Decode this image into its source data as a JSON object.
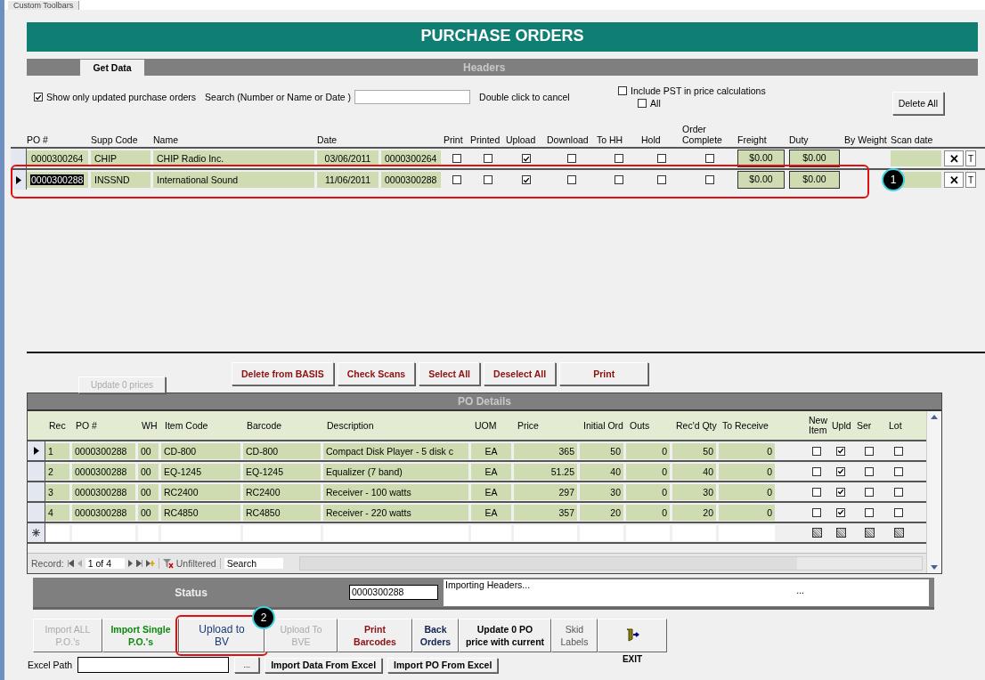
{
  "top_tab": {
    "label": "Custom Toolbars"
  },
  "title": "PURCHASE ORDERS",
  "headers_bar": {
    "tab": "Get Data",
    "title": "Headers"
  },
  "options": {
    "show_updated": {
      "label": "Show only updated purchase orders",
      "checked": true
    },
    "search": {
      "label": "Search (Number or Name or Date )"
    },
    "cancel_hint": "Double click to cancel",
    "include_pst": {
      "label": "Include PST in price calculations",
      "checked": false
    },
    "all": {
      "label": "All",
      "checked": false
    },
    "delete_all": "Delete All"
  },
  "headers_table": {
    "columns": [
      "PO #",
      "Supp Code",
      "Name",
      "Date",
      "Print",
      "Printed",
      "Upload",
      "Download",
      "To HH",
      "Hold",
      "Order\nComplete",
      "Freight",
      "Duty",
      "By Weight",
      "Scan date"
    ],
    "rows": [
      {
        "selected": false,
        "po": "0000300264",
        "supp_code": "CHIP",
        "name": "CHIP Radio Inc.",
        "date": "03/06/2011",
        "po_ref": "0000300264",
        "print": false,
        "printed": false,
        "upload": true,
        "download": false,
        "to_hh": false,
        "hold": false,
        "order_complete": false,
        "freight": "$0.00",
        "duty": "$0.00",
        "delete": "✕",
        "t": "T"
      },
      {
        "selected": true,
        "po": "0000300288",
        "supp_code": "INSSND",
        "name": "International Sound",
        "date": "11/06/2011",
        "po_ref": "0000300288",
        "print": false,
        "printed": false,
        "upload": true,
        "download": false,
        "to_hh": false,
        "hold": false,
        "order_complete": false,
        "freight": "$0.00",
        "duty": "$0.00",
        "delete": "✕",
        "t": "T"
      }
    ]
  },
  "actions": {
    "update_prices": {
      "label": "Update 0 prices",
      "disabled": true
    },
    "buttons": [
      "Delete from BASIS",
      "Check Scans",
      "Select All",
      "Deselect All",
      "Print"
    ]
  },
  "details": {
    "title": "PO Details",
    "columns": [
      "Rec",
      "PO #",
      "WH",
      "Item Code",
      "Barcode",
      "Description",
      "UOM",
      "Price",
      "Initial Ord",
      "Outs",
      "Rec'd Qty",
      "To Receive",
      "New\nItem",
      "Upld",
      "Ser",
      "Lot"
    ],
    "rows": [
      {
        "selected": true,
        "rec": "1",
        "po": "0000300288",
        "wh": "00",
        "item_code": "CD-800",
        "barcode": "CD-800",
        "description": "Compact Disk Player - 5 disk c",
        "uom": "EA",
        "price": "365",
        "initial_ord": "50",
        "outs": "0",
        "recd_qty": "50",
        "to_receive": "0",
        "new_item": false,
        "upld": true,
        "ser": false,
        "lot": false
      },
      {
        "selected": false,
        "rec": "2",
        "po": "0000300288",
        "wh": "00",
        "item_code": "EQ-1245",
        "barcode": "EQ-1245",
        "description": "Equalizer (7 band)",
        "uom": "EA",
        "price": "51.25",
        "initial_ord": "40",
        "outs": "0",
        "recd_qty": "40",
        "to_receive": "0",
        "new_item": false,
        "upld": true,
        "ser": false,
        "lot": false
      },
      {
        "selected": false,
        "rec": "3",
        "po": "0000300288",
        "wh": "00",
        "item_code": "RC2400",
        "barcode": "RC2400",
        "description": "Receiver - 100 watts",
        "uom": "EA",
        "price": "297",
        "initial_ord": "30",
        "outs": "0",
        "recd_qty": "30",
        "to_receive": "0",
        "new_item": false,
        "upld": true,
        "ser": false,
        "lot": false
      },
      {
        "selected": false,
        "rec": "4",
        "po": "0000300288",
        "wh": "00",
        "item_code": "RC4850",
        "barcode": "RC4850",
        "description": "Receiver - 220 watts",
        "uom": "EA",
        "price": "357",
        "initial_ord": "20",
        "outs": "0",
        "recd_qty": "20",
        "to_receive": "0",
        "new_item": false,
        "upld": true,
        "ser": false,
        "lot": false
      }
    ],
    "navigation": {
      "label": "Record:",
      "position": "1 of 4",
      "filter": "Unfiltered",
      "search": "Search"
    }
  },
  "status": {
    "label": "Status",
    "po": "0000300288",
    "message": "Importing Headers...",
    "more": "..."
  },
  "bottom_buttons": [
    {
      "label": "Import ALL\nP.O.'s",
      "kind": "disabled"
    },
    {
      "label": "Import Single\nP.O.'s",
      "kind": "green"
    },
    {
      "label": "Upload to\nBV",
      "kind": "blue"
    },
    {
      "label": "Upload To\nBVE",
      "kind": "disabled"
    },
    {
      "label": "Print\nBarcodes",
      "kind": "red"
    },
    {
      "label": "Back\nOrders",
      "kind": "navy"
    },
    {
      "label": "Update 0 PO\nprice with current",
      "kind": "bold"
    },
    {
      "label": "Skid\nLabels",
      "kind": "plain"
    }
  ],
  "exit": {
    "label": "EXIT"
  },
  "excel": {
    "label": "Excel Path",
    "browse": "...",
    "import_data": "Import Data From Excel",
    "import_po": "Import PO From Excel"
  },
  "annotations": [
    {
      "number": "1"
    },
    {
      "number": "2"
    }
  ]
}
